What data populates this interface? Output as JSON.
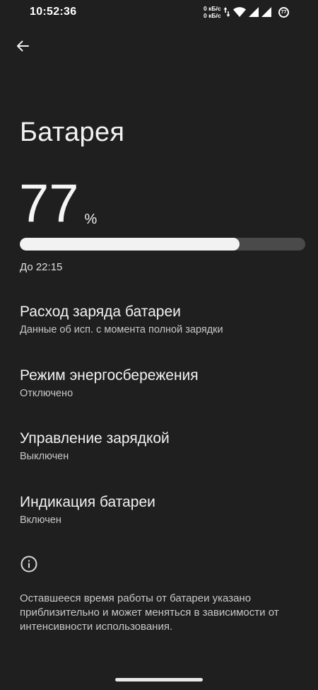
{
  "status_bar": {
    "time": "10:52:36",
    "net_up": "0 кБ/с",
    "net_down": "0 кБ/с",
    "battery_badge": "77"
  },
  "header": {
    "title": "Батарея"
  },
  "battery": {
    "level": "77",
    "unit": "%",
    "level_fraction": 0.77,
    "remaining": "До 22:15"
  },
  "settings": [
    {
      "title": "Расход заряда батареи",
      "summary": "Данные об исп. с момента полной зарядки"
    },
    {
      "title": "Режим энергосбережения",
      "summary": "Отключено"
    },
    {
      "title": "Управление зарядкой",
      "summary": "Выключен"
    },
    {
      "title": "Индикация батареи",
      "summary": "Включен"
    }
  ],
  "footer": {
    "info_text": "Оставшееся время работы от батареи указано приблизительно и может меняться в зависимости от интенсивности использования."
  }
}
